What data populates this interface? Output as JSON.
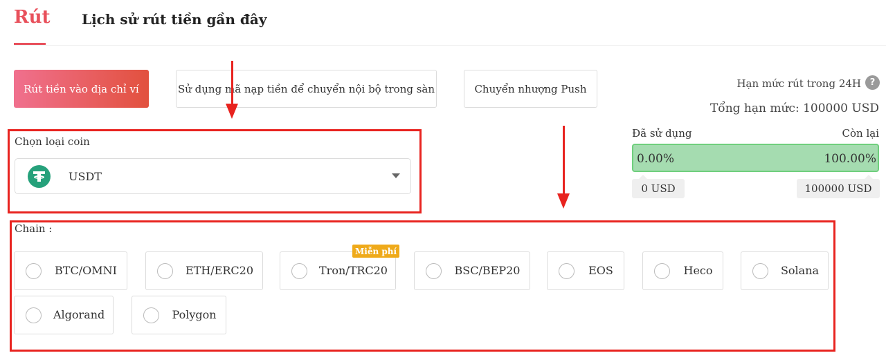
{
  "tabs": {
    "withdraw": "Rút",
    "history": "Lịch sử rút tiền gần đây"
  },
  "modes": {
    "to_address": "Rút tiền vào địa chỉ ví",
    "internal": "Sử dụng mã nạp tiền để chuyển nội bộ trong sàn",
    "push": "Chuyển nhượng Push"
  },
  "limit": {
    "title": "Hạn mức rút trong 24H",
    "help": "?",
    "total": "Tổng hạn mức: 100000 USD",
    "used_label": "Đã sử dụng",
    "remain_label": "Còn lại",
    "used_percent": "0.00%",
    "remain_percent": "100.00%",
    "used_fraction": 0.0,
    "used_amount": "0 USD",
    "remain_amount": "100000 USD",
    "bar_color": "#a5dcb0"
  },
  "coin": {
    "label": "Chọn loại coin",
    "selected": "USDT",
    "icon": "tether-icon"
  },
  "chain": {
    "label": "Chain :",
    "free_badge": "Miễn phí",
    "options": [
      "BTC/OMNI",
      "ETH/ERC20",
      "Tron/TRC20",
      "BSC/BEP20",
      "EOS",
      "Heco",
      "Solana",
      "Algorand",
      "Polygon"
    ]
  },
  "colors": {
    "accent": "#e8505b",
    "annotation": "#e8231f",
    "badge": "#efaa1a"
  }
}
